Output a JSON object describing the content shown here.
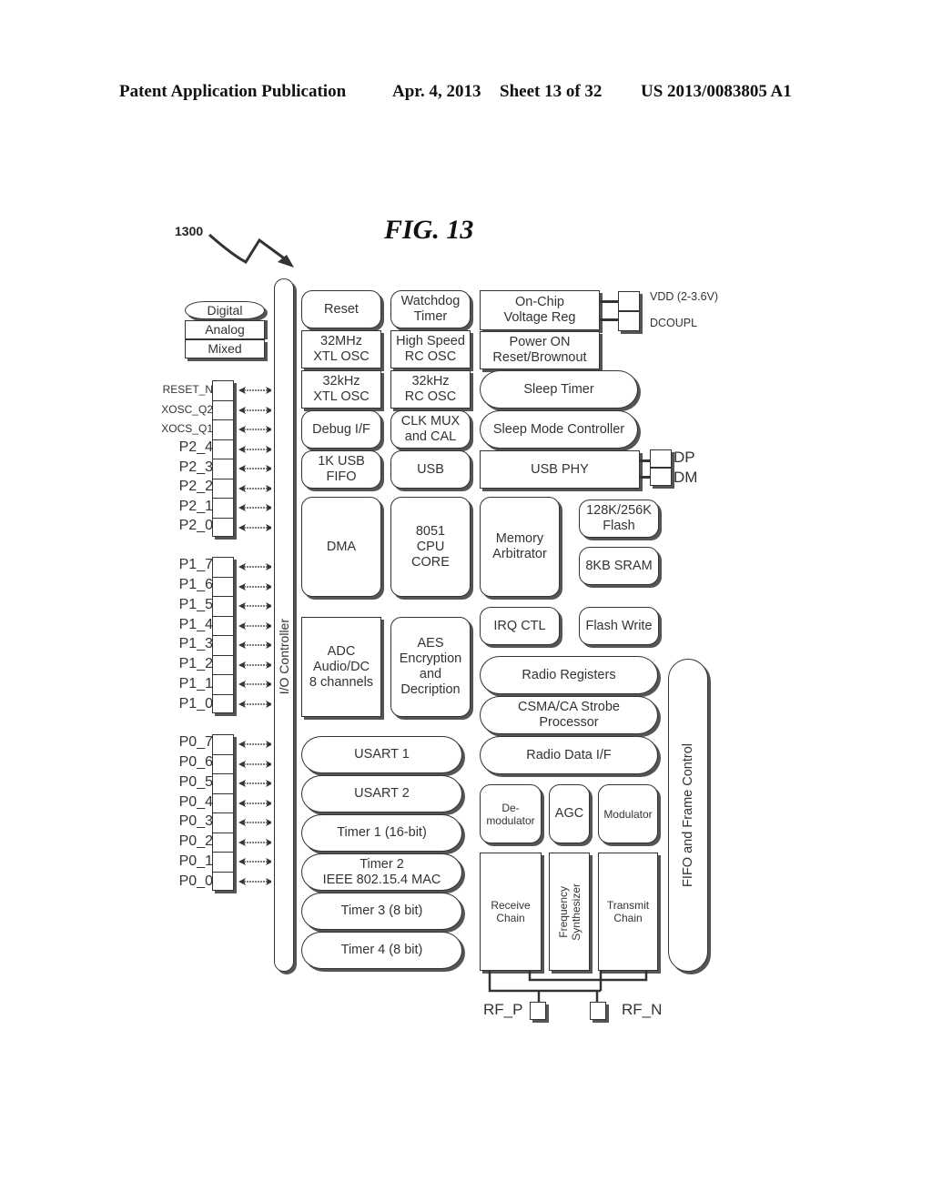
{
  "header": {
    "publication": "Patent Application Publication",
    "date": "Apr. 4, 2013",
    "sheet": "Sheet 13 of 32",
    "number": "US 2013/0083805 A1"
  },
  "figure": {
    "title": "FIG. 13",
    "ref": "1300"
  },
  "legend": [
    "Digital",
    "Analog",
    "Mixed"
  ],
  "io_controller": "I/O Controller",
  "pins": {
    "group_misc": [
      "RESET_N",
      "XOSC_Q2",
      "XOCS_Q1",
      "P2_4",
      "P2_3",
      "P2_2",
      "P2_1",
      "P2_0"
    ],
    "group_p1": [
      "P1_7",
      "P1_6",
      "P1_5",
      "P1_4",
      "P1_3",
      "P1_2",
      "P1_1",
      "P1_0"
    ],
    "group_p0": [
      "P0_7",
      "P0_6",
      "P0_5",
      "P0_4",
      "P0_3",
      "P0_2",
      "P0_1",
      "P0_0"
    ]
  },
  "blocks": {
    "reset": "Reset",
    "watchdog": "Watchdog\nTimer",
    "voltage_reg": "On-Chip\nVoltage Reg",
    "xtl32m": "32MHz\nXTL OSC",
    "rc_hs": "High Speed\nRC OSC",
    "power_on": "Power ON\nReset/Brownout",
    "xtl32k": "32kHz\nXTL OSC",
    "rc32k": "32kHz\nRC OSC",
    "sleep_timer": "Sleep Timer",
    "debug": "Debug I/F",
    "clkmux": "CLK MUX\nand CAL",
    "sleep_mode": "Sleep Mode Controller",
    "usb_fifo": "1K USB\nFIFO",
    "usb": "USB",
    "usb_phy": "USB PHY",
    "dma": "DMA",
    "cpu": "8051\nCPU\nCORE",
    "mem_arb": "Memory\nArbitrator",
    "flash": "128K/256K\nFlash",
    "sram": "8KB SRAM",
    "irq": "IRQ CTL",
    "flash_write": "Flash Write",
    "adc": "ADC\nAudio/DC\n8 channels",
    "aes": "AES\nEncryption\nand\nDecription",
    "radio_regs": "Radio Registers",
    "csma": "CSMA/CA Strobe\nProcessor",
    "radio_data": "Radio Data I/F",
    "fifo_frame": "FIFO and Frame Control",
    "usart1": "USART 1",
    "usart2": "USART 2",
    "timer1": "Timer 1 (16-bit)",
    "timer2": "Timer 2\nIEEE 802.15.4 MAC",
    "timer3": "Timer 3 (8 bit)",
    "timer4": "Timer 4 (8 bit)",
    "demod": "De-\nmodulator",
    "agc": "AGC",
    "modulator": "Modulator",
    "rx_chain": "Receive\nChain",
    "freq_synth": "Frequency\nSynthesizer",
    "tx_chain": "Transmit\nChain"
  },
  "external": {
    "vdd": "VDD (2-3.6V)",
    "dcoupl": "DCOUPL",
    "dp": "DP",
    "dm": "DM",
    "rf_p": "RF_P",
    "rf_n": "RF_N"
  }
}
